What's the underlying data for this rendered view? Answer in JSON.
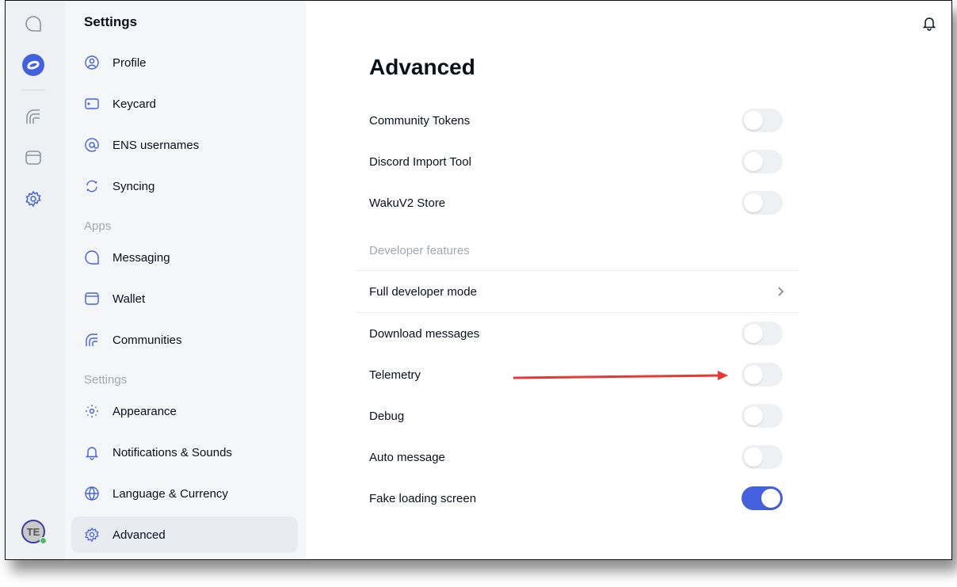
{
  "panel": {
    "title": "Settings",
    "items": [
      {
        "label": "Profile",
        "icon": "profile-icon"
      },
      {
        "label": "Keycard",
        "icon": "keycard-icon"
      },
      {
        "label": "ENS usernames",
        "icon": "at-icon"
      },
      {
        "label": "Syncing",
        "icon": "sync-icon"
      }
    ],
    "apps_header": "Apps",
    "apps": [
      {
        "label": "Messaging",
        "icon": "chat-icon"
      },
      {
        "label": "Wallet",
        "icon": "wallet-icon"
      },
      {
        "label": "Communities",
        "icon": "communities-icon"
      }
    ],
    "settings_header": "Settings",
    "settings": [
      {
        "label": "Appearance",
        "icon": "sun-icon"
      },
      {
        "label": "Notifications & Sounds",
        "icon": "bell-icon"
      },
      {
        "label": "Language & Currency",
        "icon": "globe-icon"
      },
      {
        "label": "Advanced",
        "icon": "gear-icon",
        "active": true
      }
    ]
  },
  "avatar": {
    "initials": "TE",
    "status": "online"
  },
  "main": {
    "title": "Advanced",
    "toggles_top": [
      {
        "label": "Community Tokens",
        "on": false
      },
      {
        "label": "Discord Import Tool",
        "on": false
      },
      {
        "label": "WakuV2 Store",
        "on": false
      }
    ],
    "dev_header": "Developer features",
    "full_dev": "Full developer mode",
    "toggles_dev": [
      {
        "label": "Download messages",
        "on": false
      },
      {
        "label": "Telemetry",
        "on": false
      },
      {
        "label": "Debug",
        "on": false
      },
      {
        "label": "Auto message",
        "on": false
      },
      {
        "label": "Fake loading screen",
        "on": true
      }
    ]
  },
  "colors": {
    "accent": "#4360df",
    "annotation_arrow": "#e53935"
  }
}
